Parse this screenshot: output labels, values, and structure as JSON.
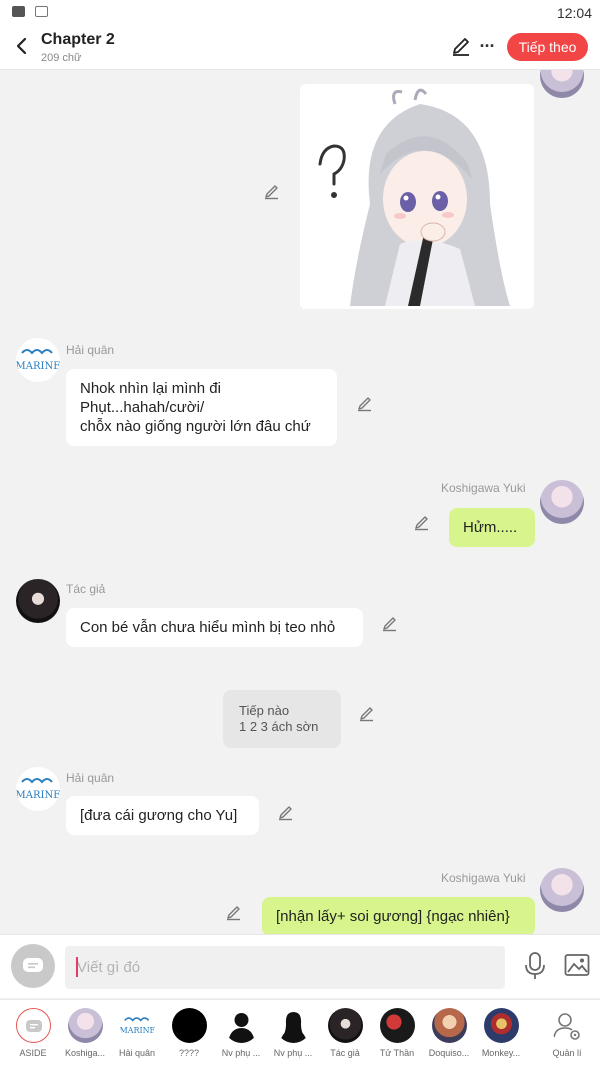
{
  "status_bar": {
    "time": "12:04"
  },
  "header": {
    "title": "Chapter 2",
    "word_count": "209 chữ",
    "follow_label": "Tiếp theo"
  },
  "messages": [
    {
      "sender": "Koshigawa Yuki",
      "side": "right",
      "type": "sticker"
    },
    {
      "sender": "Hải quân",
      "side": "left",
      "type": "text",
      "text": "Nhok nhìn lại mình đi\nPhụt...hahah/cười/\nchỗx nào giống người lớn đâu chứ"
    },
    {
      "sender": "Koshigawa Yuki",
      "side": "right",
      "type": "text",
      "text": "Hửm....."
    },
    {
      "sender": "Tác giả",
      "side": "left",
      "type": "text",
      "text": "Con bé vẫn chưa hiểu mình bị teo nhỏ"
    },
    {
      "sender": "",
      "side": "center",
      "type": "narration",
      "text": "Tiếp nào\n1 2 3 ách sờn"
    },
    {
      "sender": "Hải quân",
      "side": "left",
      "type": "text",
      "text": "[đưa cái gương cho Yu]"
    },
    {
      "sender": "Koshigawa Yuki",
      "side": "right",
      "type": "text",
      "text": "[nhận lấy+ soi gương] {ngạc nhiên}"
    }
  ],
  "input": {
    "placeholder": "Viết gì đó"
  },
  "characters": [
    {
      "label": "ASIDE",
      "icon": "aside-icon"
    },
    {
      "label": "Koshiga...",
      "icon": "avatar"
    },
    {
      "label": "Hải quân",
      "icon": "marine-logo"
    },
    {
      "label": "????",
      "icon": "avatar"
    },
    {
      "label": "Nv phụ ...",
      "icon": "silhouette-icon"
    },
    {
      "label": "Nv phụ ...",
      "icon": "silhouette-icon"
    },
    {
      "label": "Tác giả",
      "icon": "avatar"
    },
    {
      "label": "Tử Thần",
      "icon": "avatar"
    },
    {
      "label": "Doquiso...",
      "icon": "avatar"
    },
    {
      "label": "Monkey...",
      "icon": "avatar"
    },
    {
      "label": "Quản lí",
      "icon": "manage-user-icon"
    }
  ],
  "marine_logo_text": "MARINE",
  "colors": {
    "accent": "#f24545",
    "bubble_right": "#d7f58c",
    "bubble_left": "#ffffff",
    "background": "#f2f2f2"
  }
}
